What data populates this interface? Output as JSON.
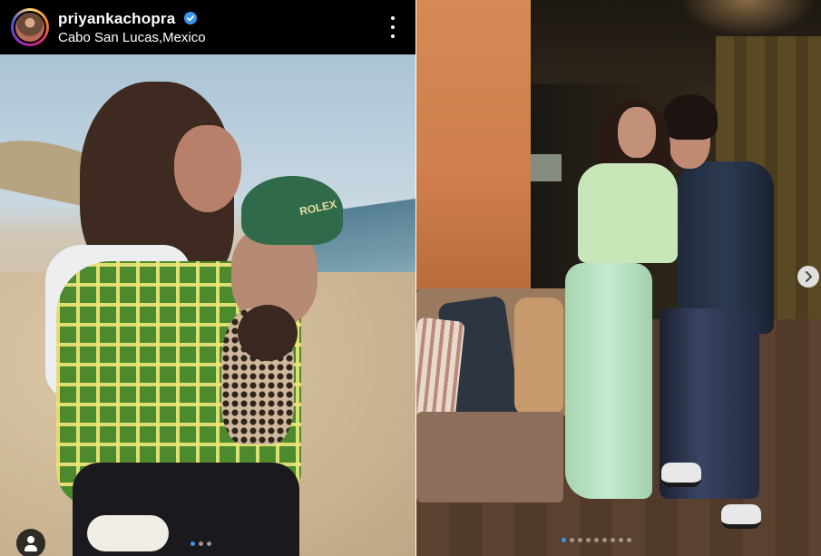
{
  "post": {
    "username": "priyankachopra",
    "verified": true,
    "location": "Cabo San Lucas,Mexico"
  },
  "icons": {
    "verified": "verified-badge-icon",
    "more": "more-options-icon",
    "profile": "user-tag-icon",
    "next": "chevron-right-icon"
  },
  "left_photo": {
    "cap_text": "ROLEX",
    "carousel_dots": 3,
    "carousel_active": 1
  },
  "right_photo": {
    "carousel_dots": 9,
    "carousel_active": 1
  },
  "colors": {
    "verified_blue": "#3897f0",
    "active_dot": "#3897f0",
    "header_bg": "#000000"
  }
}
